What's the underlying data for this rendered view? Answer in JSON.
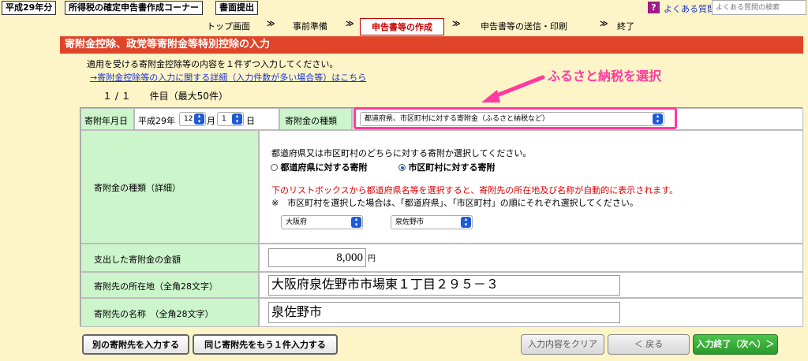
{
  "header": {
    "year_tag": "平成29年分",
    "corner_tag": "所得税の確定申告書作成コーナー",
    "print_tag": "書面提出",
    "faq_link": "よくある質問",
    "faq_search_placeholder": "よくある質問の検索"
  },
  "steps": [
    {
      "label": "トップ画面",
      "active": false
    },
    {
      "label": "事前準備",
      "active": false
    },
    {
      "label": "申告書等の作成",
      "active": true
    },
    {
      "label": "申告書等の送信・印刷",
      "active": false
    },
    {
      "label": "終了",
      "active": false
    }
  ],
  "step_separator": "≫",
  "page": {
    "title": "寄附金控除、政党等寄附金等特別控除の入力",
    "intro": "適用を受ける寄附金控除等の内容を１件ずつ入力してください。",
    "detail_link": "→寄附金控除等の入力に関する詳細（入力件数が多い場合等）はこちら",
    "count_label": "１ / １　　件目（最大50件）"
  },
  "callout": "ふるさと納税を選択",
  "form": {
    "date_label": "寄附年月日",
    "era": "平成29年",
    "month": "12",
    "month_unit": "月",
    "day": "1",
    "day_unit": "日",
    "type_label": "寄附金の種類",
    "type_value": "都道府県、市区町村に対する寄附金（ふるさと納税など）",
    "detail_label": "寄附金の種類（詳細）",
    "detail_question": "都道府県又は市区町村のどちらに対する寄附か選択してください。",
    "radio_prefecture": "都道府県に対する寄附",
    "radio_municipality": "市区町村に対する寄附",
    "selected_radio": "municipality",
    "red_note": "下のリストボックスから都道府県名等を選択すると、寄附先の所在地及び名称が自動的に表示されます。",
    "note": "※　市区町村を選択した場合は、「都道府県」、「市区町村」の順にそれぞれ選択してください。",
    "prefecture_value": "大阪府",
    "municipality_value": "泉佐野市",
    "amount_label": "支出した寄附金の金額",
    "amount_value": "8,000",
    "amount_unit": "円",
    "address_label": "寄附先の所在地（全角28文字）",
    "address_value": "大阪府泉佐野市市場東１丁目２９５－３",
    "name_label": "寄附先の名称　（全角28文字）",
    "name_value": "泉佐野市"
  },
  "buttons": {
    "add_other": "別の寄附先を入力する",
    "add_same": "同じ寄附先をもう１件入力する",
    "clear": "入力内容をクリア",
    "back": "＜ 戻る",
    "finish": "入力終了（次へ）＞"
  },
  "colors": {
    "background": "#fdf4c8",
    "banner": "#e0452a",
    "label_bg": "#ccf5cc",
    "callout": "#ff3aa0",
    "link": "#1a33cc",
    "finish_button": "#2a9a2a"
  }
}
